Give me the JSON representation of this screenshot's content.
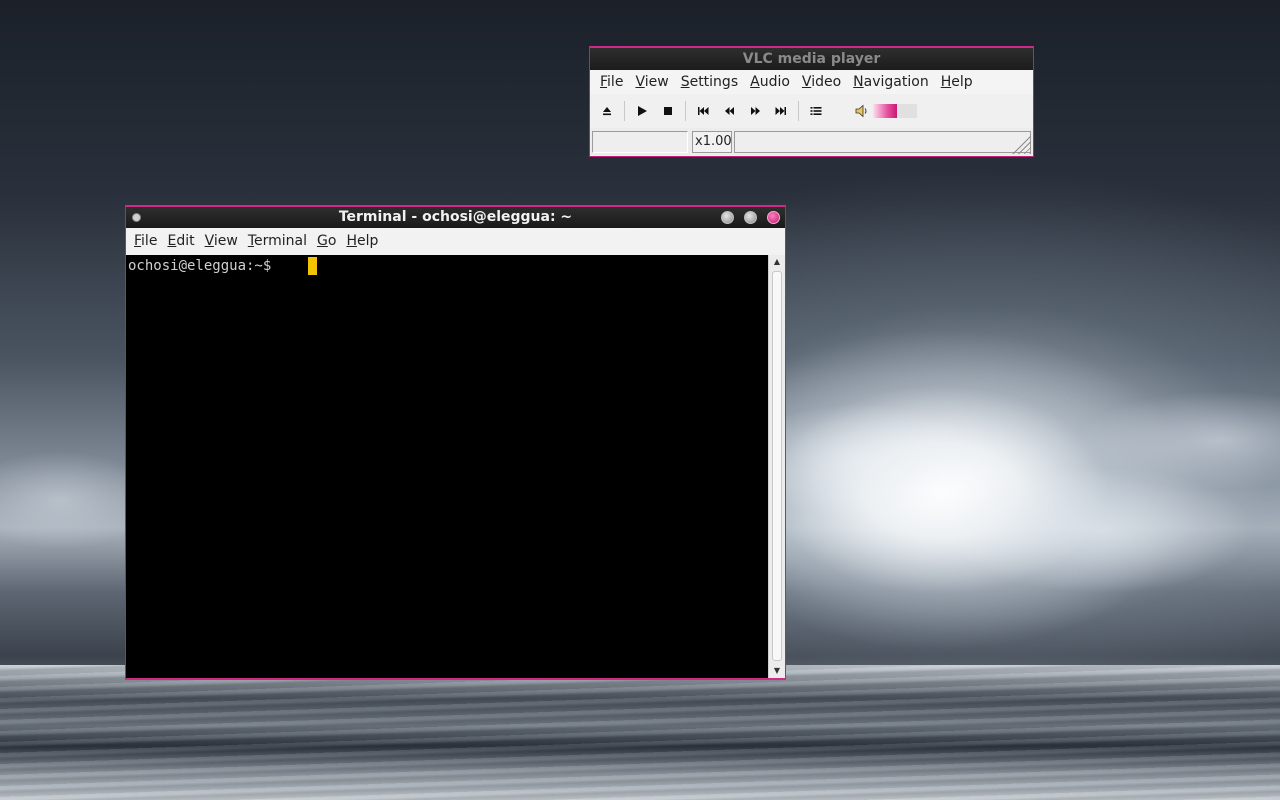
{
  "colors": {
    "accent": "#d02a86",
    "cursor": "#f5c400",
    "terminal_bg": "#000000",
    "titlebar": "#1c1c1c"
  },
  "vlc": {
    "title": "VLC media player",
    "menu": [
      "File",
      "View",
      "Settings",
      "Audio",
      "Video",
      "Navigation",
      "Help"
    ],
    "toolbar_icons": [
      "eject-icon",
      "play-icon",
      "stop-icon",
      "skip-previous-icon",
      "rewind-icon",
      "fast-forward-icon",
      "skip-next-icon",
      "playlist-icon",
      "volume-icon"
    ],
    "volume_level": 0.55,
    "speed": "x1.00"
  },
  "terminal": {
    "title": "Terminal - ochosi@eleggua: ~",
    "menu": [
      "File",
      "Edit",
      "View",
      "Terminal",
      "Go",
      "Help"
    ],
    "prompt": "ochosi@eleggua:~$ "
  }
}
